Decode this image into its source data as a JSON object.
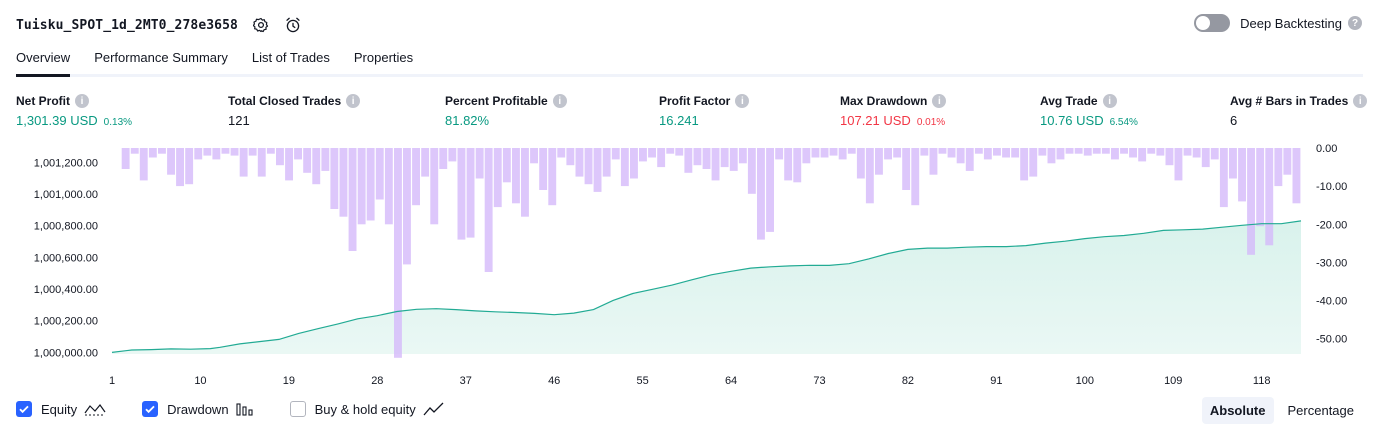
{
  "header": {
    "title": "Tuisku_SPOT_1d_2MT0_278e3658",
    "settings_icon": "gear-icon",
    "alert_icon": "alarm-clock-plus-icon"
  },
  "deep_backtesting": {
    "label": "Deep Backtesting",
    "enabled": false,
    "help_icon": "question-icon"
  },
  "tabs": [
    {
      "label": "Overview",
      "active": true
    },
    {
      "label": "Performance Summary",
      "active": false
    },
    {
      "label": "List of Trades",
      "active": false
    },
    {
      "label": "Properties",
      "active": false
    }
  ],
  "metrics": [
    {
      "label": "Net Profit",
      "value": "1,301.39 USD",
      "sub": "0.13%",
      "color": "#089981"
    },
    {
      "label": "Total Closed Trades",
      "value": "121",
      "sub": "",
      "color": "#131722"
    },
    {
      "label": "Percent Profitable",
      "value": "81.82%",
      "sub": "",
      "color": "#089981"
    },
    {
      "label": "Profit Factor",
      "value": "16.241",
      "sub": "",
      "color": "#089981"
    },
    {
      "label": "Max Drawdown",
      "value": "107.21 USD",
      "sub": "0.01%",
      "color": "#f23645"
    },
    {
      "label": "Avg Trade",
      "value": "10.76 USD",
      "sub": "6.54%",
      "color": "#089981"
    },
    {
      "label": "Avg # Bars in Trades",
      "value": "6",
      "sub": "",
      "color": "#131722"
    }
  ],
  "colors": {
    "equity_line": "#22ab94",
    "equity_fill": "#d9f2ec",
    "drawdown_bar": "#d5b9fa",
    "accent": "#2962ff"
  },
  "chart_data": {
    "type": "area",
    "x_ticks": [
      "1",
      "10",
      "19",
      "28",
      "37",
      "46",
      "55",
      "64",
      "73",
      "82",
      "91",
      "100",
      "109",
      "118"
    ],
    "y_ticks": [
      "1,001,200.00",
      "1,001,000.00",
      "1,000,800.00",
      "1,000,600.00",
      "1,000,400.00",
      "1,000,200.00",
      "1,000,000.00"
    ],
    "y_ticks_values": [
      1001200,
      1001000,
      1000800,
      1000600,
      1000400,
      1000200,
      1000000
    ],
    "y2_ticks": [
      "0.00",
      "-10.00",
      "-20.00",
      "-30.00",
      "-40.00",
      "-50.00"
    ],
    "y2_ticks_values": [
      0,
      -10,
      -20,
      -30,
      -40,
      -50
    ],
    "ylim": [
      999990,
      1001290
    ],
    "y2lim": [
      -54,
      0
    ],
    "xlim": [
      1,
      122
    ],
    "series": [
      {
        "name": "Equity",
        "type": "area",
        "points": [
          [
            1,
            1000000
          ],
          [
            3,
            1000015
          ],
          [
            5,
            1000018
          ],
          [
            7,
            1000022
          ],
          [
            9,
            1000020
          ],
          [
            11,
            1000024
          ],
          [
            12,
            1000032
          ],
          [
            14,
            1000054
          ],
          [
            16,
            1000068
          ],
          [
            18,
            1000082
          ],
          [
            20,
            1000120
          ],
          [
            22,
            1000150
          ],
          [
            24,
            1000180
          ],
          [
            26,
            1000212
          ],
          [
            28,
            1000232
          ],
          [
            30,
            1000258
          ],
          [
            32,
            1000272
          ],
          [
            34,
            1000276
          ],
          [
            36,
            1000270
          ],
          [
            38,
            1000262
          ],
          [
            40,
            1000256
          ],
          [
            42,
            1000252
          ],
          [
            44,
            1000246
          ],
          [
            46,
            1000238
          ],
          [
            48,
            1000248
          ],
          [
            50,
            1000270
          ],
          [
            52,
            1000328
          ],
          [
            54,
            1000372
          ],
          [
            56,
            1000398
          ],
          [
            58,
            1000425
          ],
          [
            60,
            1000458
          ],
          [
            62,
            1000490
          ],
          [
            64,
            1000512
          ],
          [
            66,
            1000532
          ],
          [
            68,
            1000540
          ],
          [
            70,
            1000546
          ],
          [
            72,
            1000550
          ],
          [
            74,
            1000549
          ],
          [
            76,
            1000560
          ],
          [
            78,
            1000590
          ],
          [
            80,
            1000624
          ],
          [
            82,
            1000650
          ],
          [
            84,
            1000658
          ],
          [
            86,
            1000658
          ],
          [
            88,
            1000664
          ],
          [
            90,
            1000668
          ],
          [
            92,
            1000668
          ],
          [
            94,
            1000674
          ],
          [
            96,
            1000690
          ],
          [
            98,
            1000702
          ],
          [
            100,
            1000718
          ],
          [
            102,
            1000730
          ],
          [
            104,
            1000738
          ],
          [
            106,
            1000752
          ],
          [
            108,
            1000770
          ],
          [
            110,
            1000774
          ],
          [
            112,
            1000778
          ],
          [
            114,
            1000790
          ],
          [
            116,
            1000802
          ],
          [
            118,
            1000812
          ],
          [
            120,
            1000812
          ],
          [
            122,
            1000830
          ]
        ]
      },
      {
        "name": "Drawdown",
        "type": "bar",
        "values": [
          0,
          -5.5,
          -1.5,
          -8.5,
          -2.5,
          -1.5,
          -7,
          -10,
          -9.5,
          -3,
          -2,
          -3,
          -1.5,
          -2,
          -7.5,
          -2,
          -7.5,
          -1.5,
          -4.5,
          -8.5,
          -3,
          -6.5,
          -9.5,
          -6,
          -16,
          -18,
          -27,
          -20,
          -19,
          -13.5,
          -20,
          -55,
          -30.5,
          -15,
          -7.5,
          -20,
          -5.5,
          -3.5,
          -24,
          -23.5,
          -8,
          -32.5,
          -15.5,
          -9,
          -14.5,
          -18,
          -4,
          -11,
          -15,
          -2.5,
          -4.5,
          -7.5,
          -9.5,
          -11.5,
          -7.5,
          -3,
          -10,
          -8,
          -3.5,
          -2.5,
          -5,
          -1.5,
          -2,
          -6.5,
          -4.5,
          -5.5,
          -8.5,
          -5,
          -6,
          -4,
          -12,
          -24,
          -22,
          -3,
          -8.5,
          -9,
          -4,
          -2.5,
          -2.5,
          -2,
          -3,
          -1.5,
          -8,
          -14.5,
          -7,
          -3,
          -2.5,
          -11,
          -15,
          -2,
          -7,
          -1.5,
          -2.5,
          -4,
          -6,
          -1.5,
          -3,
          -2,
          -2.5,
          -2.5,
          -8.5,
          -7.5,
          -2,
          -4,
          -3,
          -1.5,
          -1.5,
          -2,
          -1.5,
          -1.5,
          -3,
          -1.5,
          -2.5,
          -3.5,
          -1.5,
          -2,
          -4.5,
          -8.5,
          -2,
          -2.5,
          -5,
          -3,
          -15.5,
          -8,
          -14,
          -28,
          -20.5,
          -25.5,
          -10,
          -7,
          -14.5
        ]
      }
    ]
  },
  "legend": [
    {
      "label": "Equity",
      "checked": true,
      "icon": "area-line-icon"
    },
    {
      "label": "Drawdown",
      "checked": true,
      "icon": "bar-chart-icon"
    },
    {
      "label": "Buy & hold equity",
      "checked": false,
      "icon": "line-chart-icon"
    }
  ],
  "view_toggle": {
    "absolute": "Absolute",
    "percentage": "Percentage",
    "active": "Absolute"
  }
}
